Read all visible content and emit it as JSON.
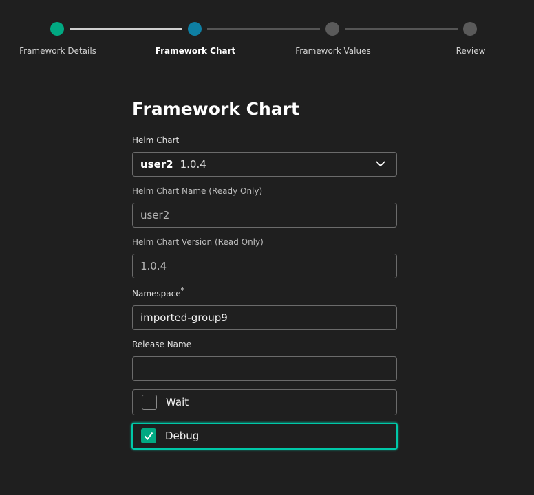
{
  "stepper": {
    "steps": [
      {
        "label": "Framework Details",
        "state": "done"
      },
      {
        "label": "Framework Chart",
        "state": "active"
      },
      {
        "label": "Framework Values",
        "state": "todo"
      },
      {
        "label": "Review",
        "state": "todo"
      }
    ]
  },
  "form": {
    "title": "Framework Chart",
    "helm_chart": {
      "label": "Helm Chart",
      "selected_name": "user2",
      "selected_version": "1.0.4",
      "icon": "chevron-down-icon"
    },
    "chart_name": {
      "label": "Helm Chart Name (Ready Only)",
      "value": "user2"
    },
    "chart_version": {
      "label": "Helm Chart Version (Read Only)",
      "value": "1.0.4"
    },
    "namespace": {
      "label": "Namespace",
      "required_mark": "*",
      "value": "imported-group9"
    },
    "release_name": {
      "label": "Release Name",
      "value": ""
    },
    "wait": {
      "label": "Wait",
      "checked": false
    },
    "debug": {
      "label": "Debug",
      "checked": true
    }
  },
  "colors": {
    "background": "#1f1f1f",
    "done": "#01a982",
    "active": "#0e7fa3",
    "focus": "#00c8a8"
  }
}
